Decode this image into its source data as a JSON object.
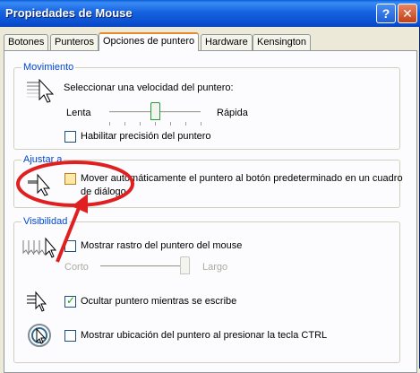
{
  "window": {
    "title": "Propiedades de Mouse",
    "help_label": "?",
    "close_label": "✕"
  },
  "tabs": [
    "Botones",
    "Punteros",
    "Opciones de puntero",
    "Hardware",
    "Kensington"
  ],
  "movimiento": {
    "legend": "Movimiento",
    "speed_label": "Seleccionar una velocidad del puntero:",
    "slow_label": "Lenta",
    "fast_label": "Rápida",
    "speed_level_percent": 50,
    "precision_label": "Habilitar precisión del puntero",
    "precision_checked": false
  },
  "ajustar": {
    "legend": "Ajustar a",
    "snap_label_line1": "Mover automáticamente el puntero al botón predeterminado en un cuadro",
    "snap_label_line2": "de diálogo",
    "snap_checked": false
  },
  "visibilidad": {
    "legend": "Visibilidad",
    "trails_label": "Mostrar rastro del puntero del mouse",
    "trails_checked": false,
    "short_label": "Corto",
    "long_label": "Largo",
    "trails_level_percent": 100,
    "hide_label": "Ocultar puntero mientras se escribe",
    "hide_checked": true,
    "ctrl_label": "Mostrar ubicación del puntero al presionar la tecla CTRL",
    "ctrl_checked": false
  },
  "colors": {
    "title_bar": "#0b4fd0",
    "legend": "#0046d5",
    "annotation": "#e02020",
    "tab_accent": "#e68b2c"
  }
}
